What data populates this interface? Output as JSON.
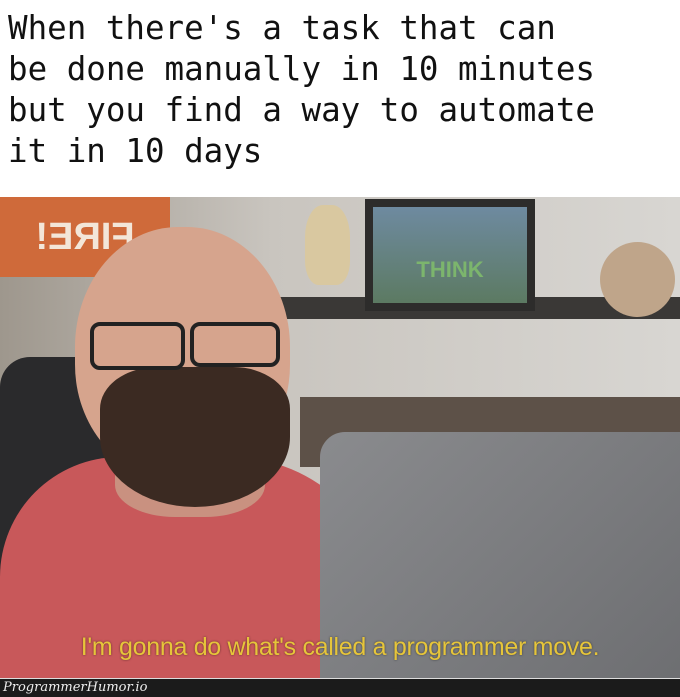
{
  "meme": {
    "caption": "When there's a task that can\nbe done manually in 10 minutes\nbut you find a way to automate\nit in 10 days",
    "photo": {
      "background_sign": "FIRE!",
      "frame_text": "THINK",
      "subtitle": "I'm gonna do what's called a programmer move.",
      "subtitle_color": "#e6c53a"
    },
    "watermark": "ProgrammerHumor.io"
  }
}
